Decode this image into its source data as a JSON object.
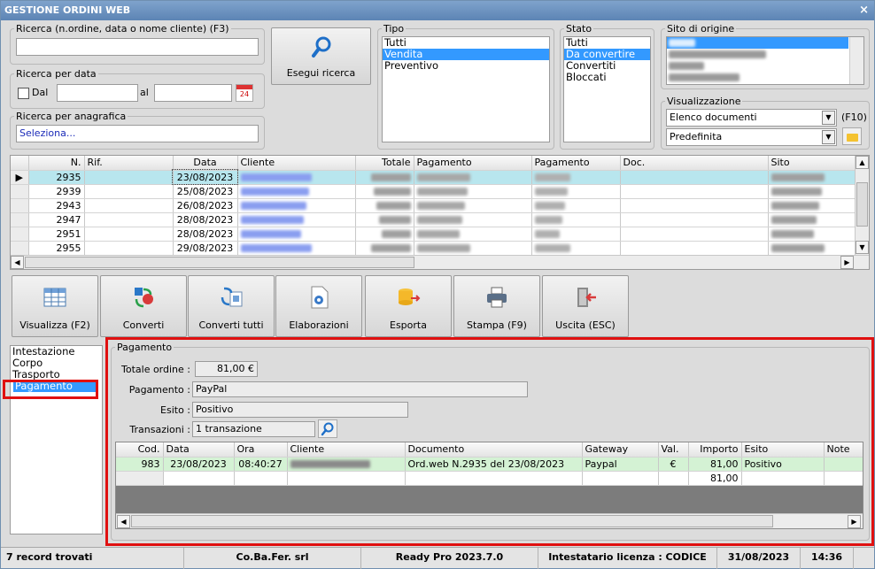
{
  "window": {
    "title": "GESTIONE ORDINI WEB",
    "close": "×"
  },
  "search": {
    "legend": "Ricerca (n.ordine, data o nome cliente) (F3)",
    "value": "",
    "button": "Esegui ricerca"
  },
  "date_search": {
    "legend": "Ricerca per data",
    "from_label": "Dal",
    "to_label": "al",
    "from": "",
    "to": "",
    "cal_text": "24"
  },
  "anag_search": {
    "legend": "Ricerca per anagrafica",
    "value": "Seleziona..."
  },
  "tipo": {
    "legend": "Tipo",
    "items": [
      "Tutti",
      "Vendita",
      "Preventivo"
    ],
    "selected": "Vendita"
  },
  "stato": {
    "legend": "Stato",
    "items": [
      "Tutti",
      "Da convertire",
      "Convertiti",
      "Bloccati"
    ],
    "selected": "Da convertire"
  },
  "sito": {
    "legend": "Sito di origine"
  },
  "visual": {
    "legend": "Visualizzazione",
    "combo1": "Elenco documenti",
    "hotkey": "(F10)",
    "combo2": "Predefinita"
  },
  "orders": {
    "headers": [
      "",
      "N.",
      "Rif.",
      "Data",
      "Cliente",
      "Totale",
      "Pagamento",
      "Pagamento",
      "Doc.",
      "Sito"
    ],
    "rows": [
      {
        "n": "2935",
        "data": "23/08/2023",
        "marker": "▶",
        "selected": true
      },
      {
        "n": "2939",
        "data": "25/08/2023",
        "marker": ""
      },
      {
        "n": "2943",
        "data": "26/08/2023",
        "marker": ""
      },
      {
        "n": "2947",
        "data": "28/08/2023",
        "marker": ""
      },
      {
        "n": "2951",
        "data": "28/08/2023",
        "marker": ""
      },
      {
        "n": "2955",
        "data": "29/08/2023",
        "marker": ""
      }
    ]
  },
  "toolbar": [
    {
      "label": "Visualizza (F2)",
      "icon": "table-view-icon"
    },
    {
      "label": "Converti",
      "icon": "convert-icon"
    },
    {
      "label": "Converti tutti",
      "icon": "convert-all-icon"
    },
    {
      "label": "Elaborazioni",
      "icon": "document-gear-icon"
    },
    {
      "label": "Esporta",
      "icon": "export-database-icon"
    },
    {
      "label": "Stampa (F9)",
      "icon": "printer-icon"
    },
    {
      "label": "Uscita (ESC)",
      "icon": "exit-door-icon"
    }
  ],
  "sections": {
    "items": [
      "Intestazione",
      "Corpo",
      "Trasporto",
      "Pagamento"
    ],
    "selected": "Pagamento"
  },
  "payment": {
    "legend": "Pagamento",
    "totale_label": "Totale ordine :",
    "totale": "81,00 €",
    "pagamento_label": "Pagamento :",
    "pagamento": "PayPal",
    "esito_label": "Esito :",
    "esito": "Positivo",
    "transazioni_label": "Transazioni :",
    "transazioni": "1 transazione",
    "tx_headers": [
      "Cod.",
      "Data",
      "Ora",
      "Cliente",
      "Documento",
      "Gateway",
      "Val.",
      "Importo",
      "Esito",
      "Note"
    ],
    "tx_row": {
      "cod": "983",
      "data": "23/08/2023",
      "ora": "08:40:27",
      "documento": "Ord.web N.2935 del 23/08/2023",
      "gateway": "Paypal",
      "val": "€",
      "importo": "81,00",
      "esito": "Positivo"
    },
    "tx_total": "81,00"
  },
  "status": {
    "records": "7 record trovati",
    "company": "Co.Ba.Fer. srl",
    "version": "Ready Pro 2023.7.0",
    "license": "Intestatario licenza : CODICE SRL",
    "date": "31/08/2023",
    "time": "14:36"
  },
  "colors": {
    "title": "#5c84b4",
    "selection": "#3399ff",
    "row_highlight": "#b8e6ee",
    "tx_row": "#d4f2d4",
    "callout": "#e01010"
  }
}
